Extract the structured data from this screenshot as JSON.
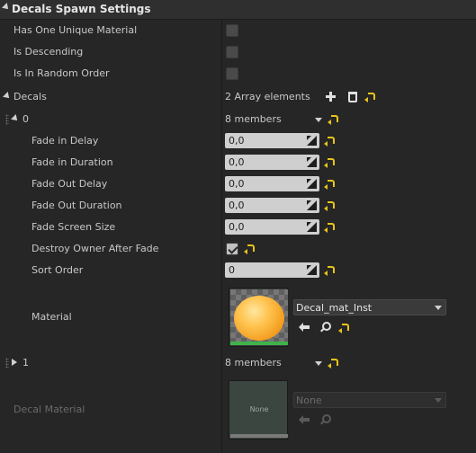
{
  "panel": {
    "title": "Decals Spawn Settings"
  },
  "props": {
    "has_one_unique_material": {
      "label": "Has One Unique Material",
      "checked": false
    },
    "is_descending": {
      "label": "Is Descending",
      "checked": false
    },
    "is_in_random_order": {
      "label": "Is In Random Order",
      "checked": false
    }
  },
  "decals": {
    "label": "Decals",
    "count_text": "2 Array elements",
    "elements": [
      {
        "index": "0",
        "members_text": "8 members",
        "fields": {
          "fade_in_delay": {
            "label": "Fade in Delay",
            "value": "0,0"
          },
          "fade_in_duration": {
            "label": "Fade in Duration",
            "value": "0,0"
          },
          "fade_out_delay": {
            "label": "Fade Out Delay",
            "value": "0,0"
          },
          "fade_out_duration": {
            "label": "Fade Out Duration",
            "value": "0,0"
          },
          "fade_screen_size": {
            "label": "Fade Screen Size",
            "value": "0,0"
          },
          "destroy_owner_after_fade": {
            "label": "Destroy Owner After Fade",
            "checked": true
          },
          "sort_order": {
            "label": "Sort Order",
            "value": "0"
          },
          "material": {
            "label": "Material",
            "asset": "Decal_mat_Inst"
          }
        }
      },
      {
        "index": "1",
        "members_text": "8 members"
      }
    ]
  },
  "decal_material": {
    "label": "Decal Material",
    "thumb_text": "None",
    "asset": "None"
  },
  "colors": {
    "reset": "#e8c41a",
    "thumb_bar": "#3fb34a"
  }
}
